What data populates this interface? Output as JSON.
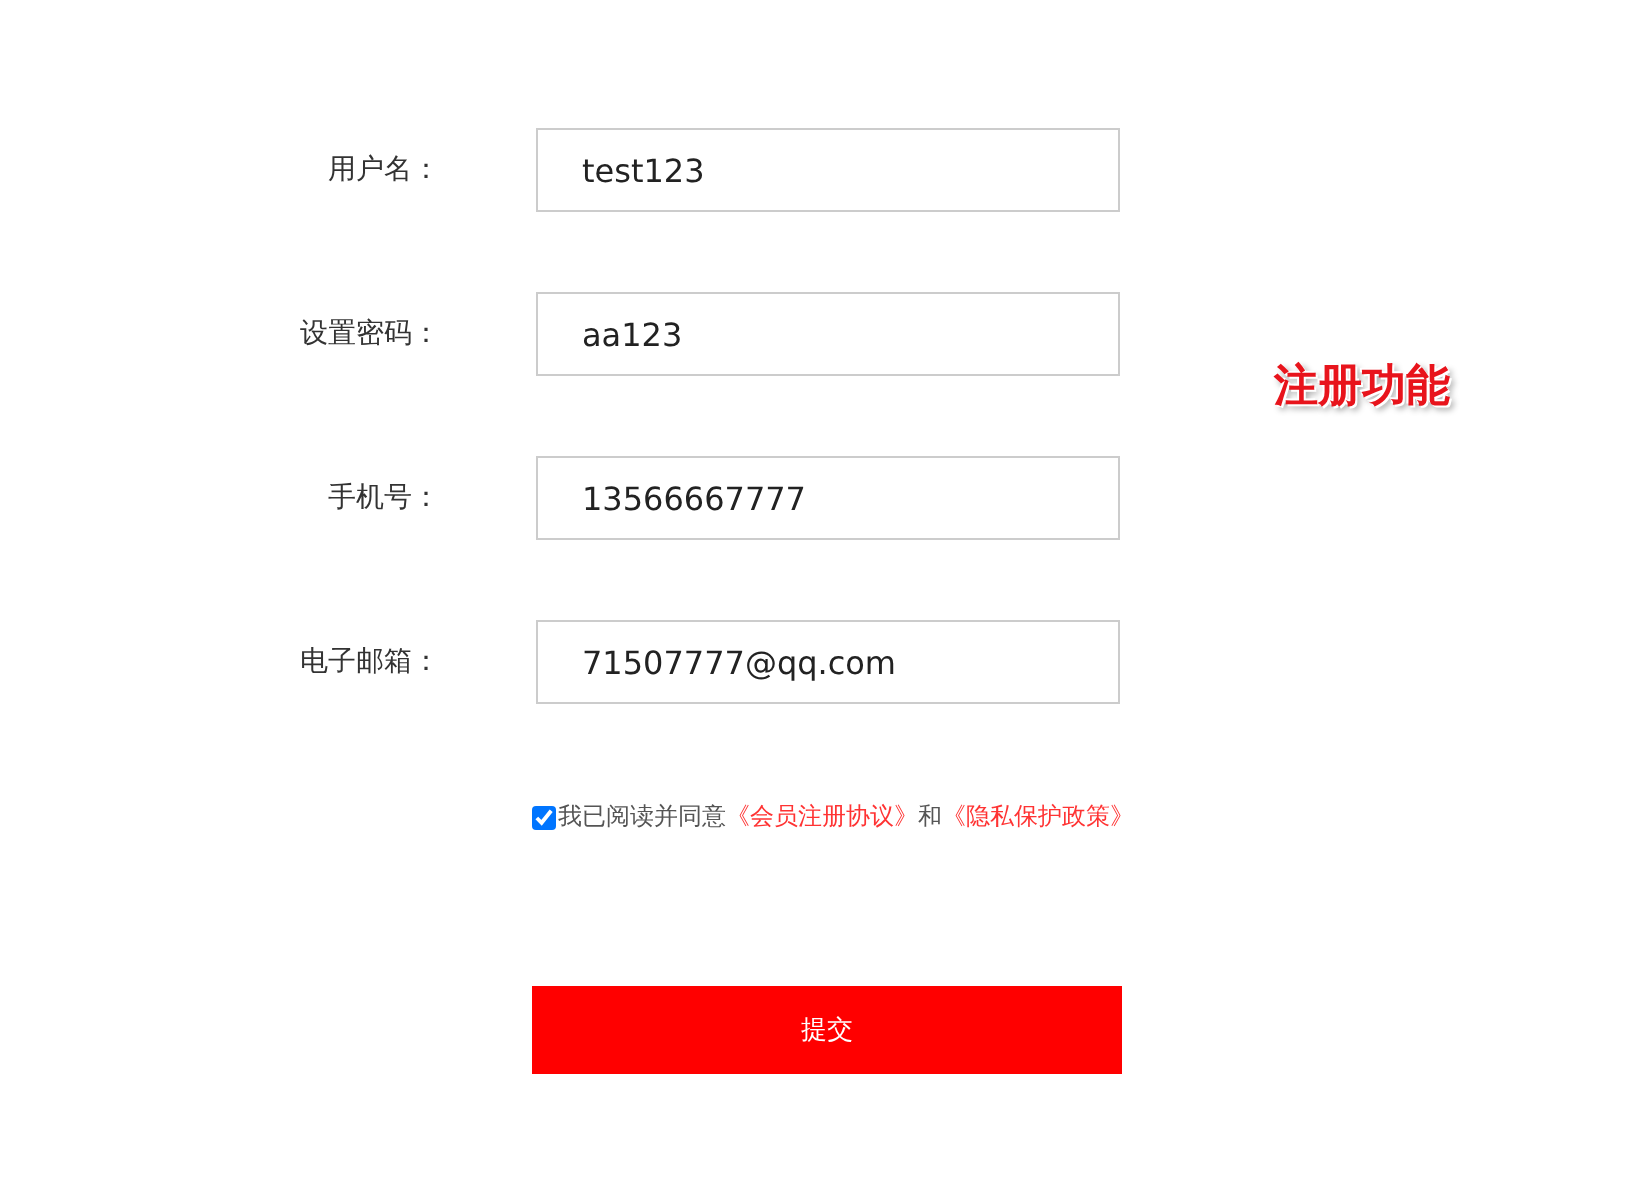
{
  "fields": [
    {
      "label": "用户名：",
      "value": "test123"
    },
    {
      "label": "设置密码：",
      "value": "aa123"
    },
    {
      "label": "手机号：",
      "value": "13566667777"
    },
    {
      "label": "电子邮箱：",
      "value": "71507777@qq.com"
    }
  ],
  "agreement": {
    "checked": true,
    "parts": [
      {
        "kind": "text",
        "text": "我已阅读并同意"
      },
      {
        "kind": "link",
        "text": "《会员注册协议》"
      },
      {
        "kind": "text",
        "text": "和"
      },
      {
        "kind": "link",
        "text": "《隐私保护政策》"
      }
    ]
  },
  "submit": "提交",
  "caption": "注册功能"
}
